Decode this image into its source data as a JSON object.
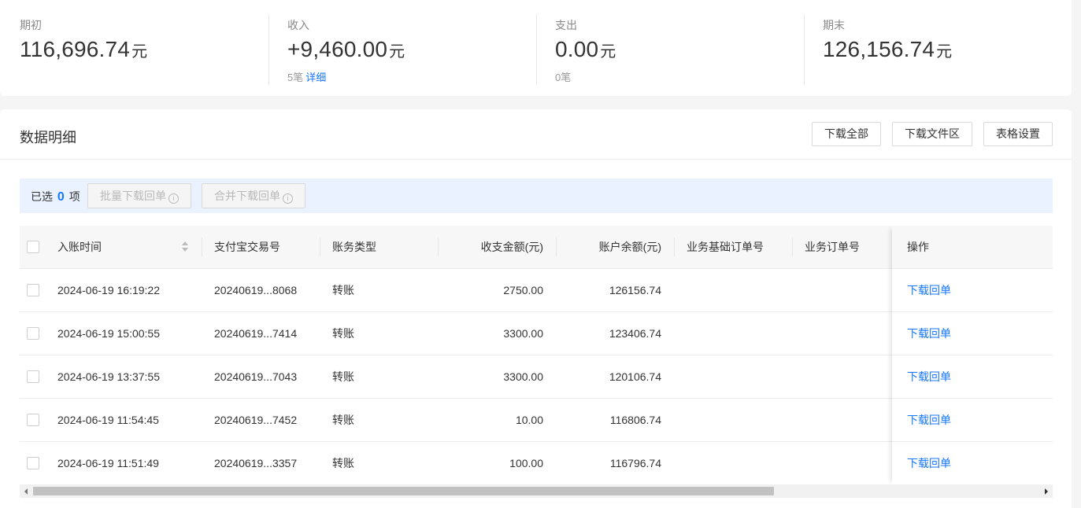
{
  "summary": {
    "opening": {
      "label": "期初",
      "value": "116,696.74",
      "unit": "元"
    },
    "income": {
      "label": "收入",
      "value": "+9,460.00",
      "unit": "元",
      "count": "5笔",
      "detail_link": "详细"
    },
    "expense": {
      "label": "支出",
      "value": "0.00",
      "unit": "元",
      "count": "0笔"
    },
    "closing": {
      "label": "期末",
      "value": "126,156.74",
      "unit": "元"
    }
  },
  "panel": {
    "title": "数据明细",
    "buttons": {
      "download_all": "下载全部",
      "download_file_area": "下载文件区",
      "table_settings": "表格设置"
    }
  },
  "selection": {
    "prefix": "已选",
    "count": "0",
    "suffix": "项",
    "batch_download": "批量下载回单",
    "merge_download": "合并下载回单",
    "info_glyph": "i"
  },
  "table": {
    "columns": [
      "入账时间",
      "支付宝交易号",
      "账务类型",
      "收支金额(元)",
      "账户余额(元)",
      "业务基础订单号",
      "业务订单号",
      "操作"
    ],
    "rows": [
      {
        "time": "2024-06-19 16:19:22",
        "trade_no": "20240619...8068",
        "type": "转账",
        "amount": "2750.00",
        "balance": "126156.74",
        "base_order": "",
        "order": "",
        "action": "下载回单"
      },
      {
        "time": "2024-06-19 15:00:55",
        "trade_no": "20240619...7414",
        "type": "转账",
        "amount": "3300.00",
        "balance": "123406.74",
        "base_order": "",
        "order": "",
        "action": "下载回单"
      },
      {
        "time": "2024-06-19 13:37:55",
        "trade_no": "20240619...7043",
        "type": "转账",
        "amount": "3300.00",
        "balance": "120106.74",
        "base_order": "",
        "order": "",
        "action": "下载回单"
      },
      {
        "time": "2024-06-19 11:54:45",
        "trade_no": "20240619...7452",
        "type": "转账",
        "amount": "10.00",
        "balance": "116806.74",
        "base_order": "",
        "order": "",
        "action": "下载回单"
      },
      {
        "time": "2024-06-19 11:51:49",
        "trade_no": "20240619...3357",
        "type": "转账",
        "amount": "100.00",
        "balance": "116796.74",
        "base_order": "",
        "order": "",
        "action": "下载回单"
      }
    ]
  },
  "icons": {
    "sort": "sort-icon",
    "info": "info-circle-icon",
    "scroll_left": "scroll-left-arrow-icon",
    "scroll_right": "scroll-right-arrow-icon"
  },
  "colors": {
    "accent": "#1677ff",
    "selection_bar": "#eaf2ff",
    "header_bg": "#f7f7f7"
  }
}
